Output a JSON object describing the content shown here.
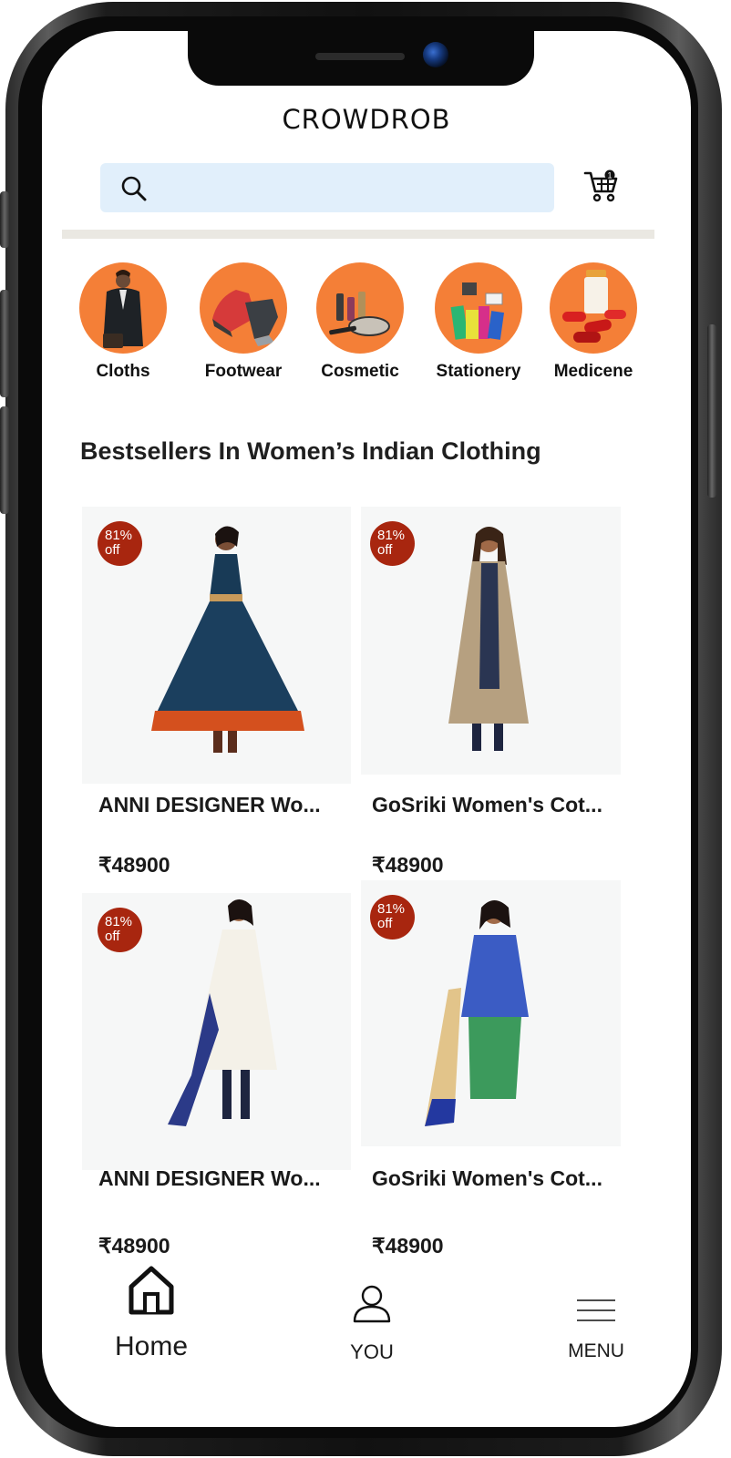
{
  "app": {
    "logo_text": "CROWDROB"
  },
  "search": {
    "placeholder": "",
    "value": ""
  },
  "cart": {
    "badge_count": "1"
  },
  "categories": [
    {
      "label": "Cloths",
      "icon": "man-in-coat-icon"
    },
    {
      "label": "Footwear",
      "icon": "sneaker-icon"
    },
    {
      "label": "Cosmetic",
      "icon": "makeup-kit-icon"
    },
    {
      "label": "Stationery",
      "icon": "office-supplies-icon"
    },
    {
      "label": "Medicene",
      "icon": "pills-bottle-icon"
    }
  ],
  "colors": {
    "accent_orange": "#f47f37",
    "badge_red": "#a8260f",
    "search_bg": "#e1effb"
  },
  "section": {
    "title": "Bestsellers In Women’s Indian Clothing"
  },
  "products": [
    {
      "name": "ANNI DESIGNER Wo...",
      "price": "₹48900",
      "discount_value": "81%",
      "discount_unit": "off"
    },
    {
      "name": "GoSriki Women's Cot...",
      "price": "₹48900",
      "discount_value": "81%",
      "discount_unit": "off"
    },
    {
      "name": "ANNI DESIGNER Wo...",
      "price": "₹48900",
      "discount_value": "81%",
      "discount_unit": "off"
    },
    {
      "name": "GoSriki Women's Cot...",
      "price": "₹48900",
      "discount_value": "81%",
      "discount_unit": "off"
    }
  ],
  "bottom_nav": [
    {
      "label": "Home",
      "icon": "home-icon"
    },
    {
      "label": "YOU",
      "icon": "user-icon"
    },
    {
      "label": "MENU",
      "icon": "hamburger-menu-icon"
    }
  ]
}
